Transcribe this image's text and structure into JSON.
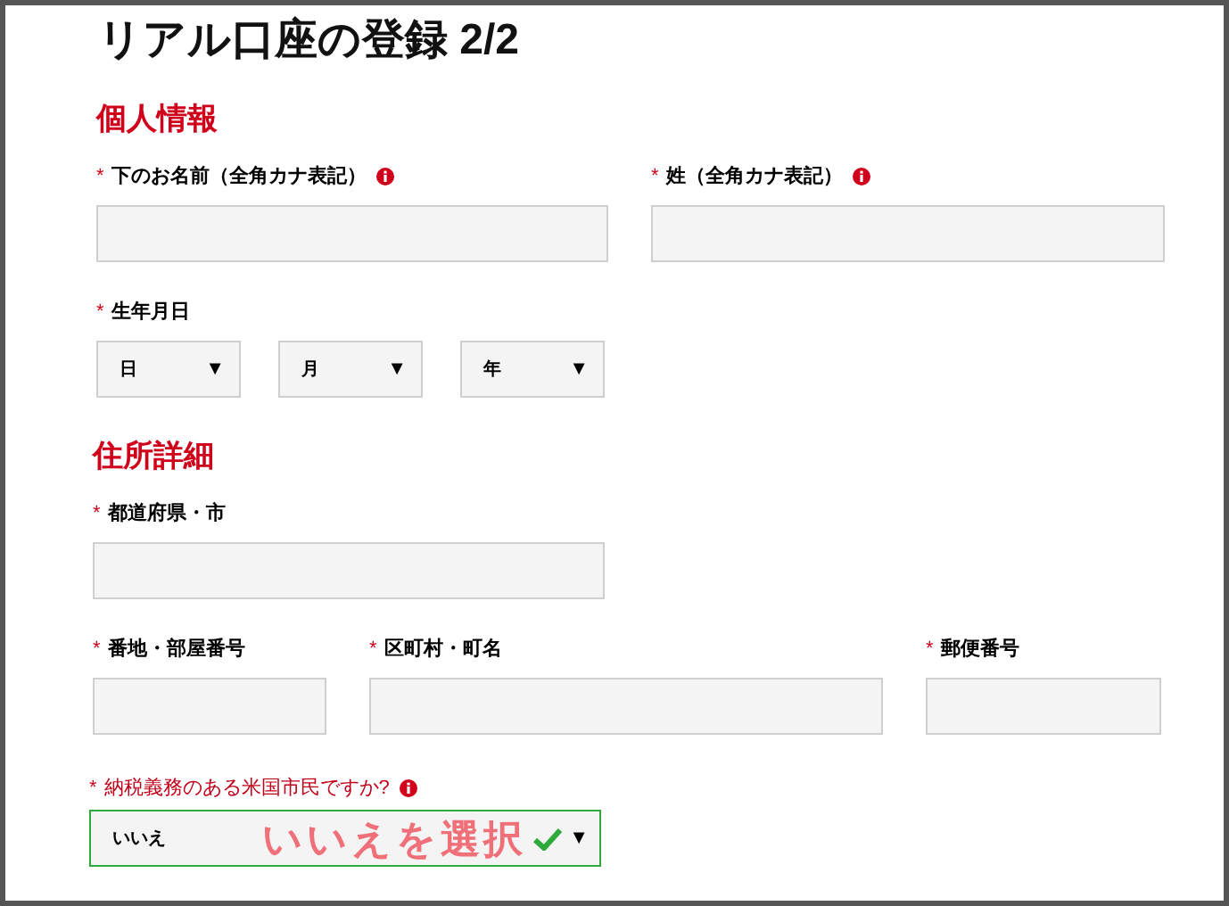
{
  "title": "リアル口座の登録 2/2",
  "sections": [
    {
      "heading": "個人情報",
      "rows": [
        [
          {
            "kind": "text",
            "label": "下のお名前（全角カナ表記）",
            "required": "*",
            "info": true
          },
          {
            "kind": "text",
            "label": "姓（全角カナ表記）",
            "required": "*",
            "info": true
          }
        ],
        [
          {
            "kind": "group",
            "label": "生年月日",
            "required": "*",
            "info": false,
            "selects": [
              {
                "value": "日",
                "arrow": "▼"
              },
              {
                "value": "月",
                "arrow": "▼"
              },
              {
                "value": "年",
                "arrow": "▼"
              }
            ]
          }
        ]
      ]
    },
    {
      "heading": "住所詳細",
      "rows": [
        [
          {
            "kind": "text",
            "label": "都道府県・市",
            "required": "*",
            "info": false
          }
        ],
        [
          {
            "kind": "text",
            "label": "番地・部屋番号",
            "required": "*",
            "info": false
          },
          {
            "kind": "text",
            "label": "区町村・町名",
            "required": "*",
            "info": false
          },
          {
            "kind": "text",
            "label": "郵便番号",
            "required": "*",
            "info": false
          }
        ]
      ]
    }
  ],
  "tax_question": {
    "label": "納税義務のある米国市民ですか?",
    "required": "*",
    "info": true,
    "value": "いいえ",
    "valid": true,
    "arrow": "▼",
    "annotation": "いいえを選択"
  }
}
